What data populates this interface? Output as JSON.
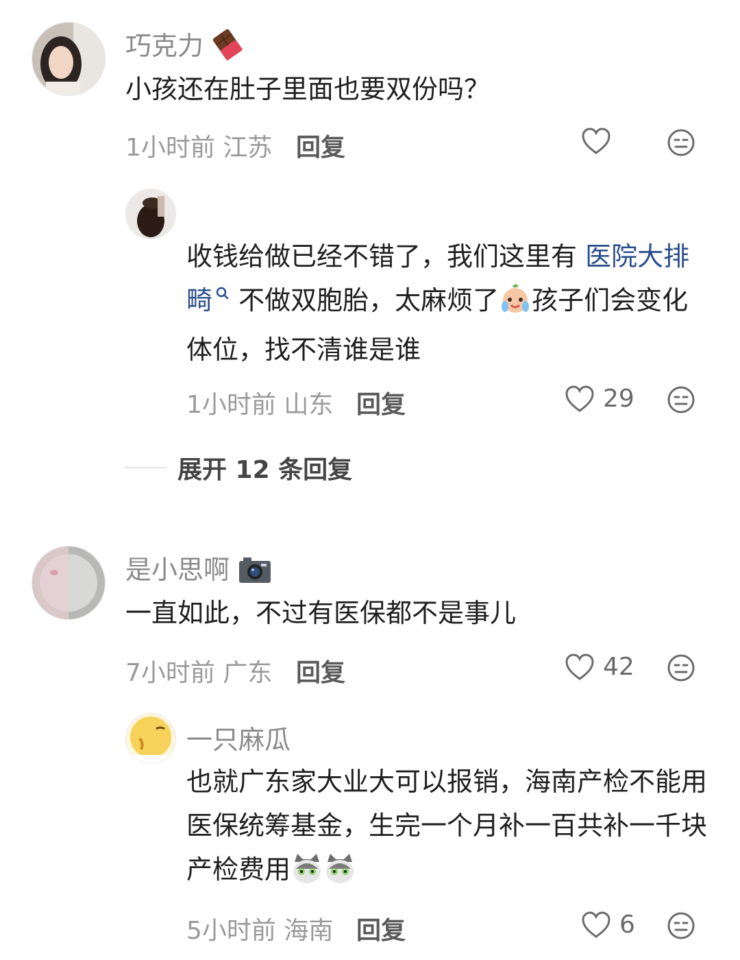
{
  "comments": [
    {
      "username": "巧克力",
      "text": "小孩还在肚子里面也要双份吗？",
      "time": "1小时前",
      "location": "江苏",
      "reply_label": "回复",
      "likes": ""
    },
    {
      "text_prefix": "收钱给做已经不错了，我们这里有 ",
      "link_text": "医院大排畸",
      "text_mid": " 不做双胞胎，太麻烦了",
      "text_suffix": "孩子们会变化体位，找不清谁是谁",
      "time": "1小时前",
      "location": "山东",
      "reply_label": "回复",
      "likes": "29"
    },
    {
      "username": "是小思啊",
      "text": "一直如此，不过有医保都不是事儿",
      "time": "7小时前",
      "location": "广东",
      "reply_label": "回复",
      "likes": "42"
    },
    {
      "username": "一只麻瓜",
      "text": "也就广东家大业大可以报销，海南产检不能用医保统筹基金，生完一个月补一百共补一千块产检费用",
      "time": "5小时前",
      "location": "海南",
      "reply_label": "回复",
      "likes": "6"
    }
  ],
  "expand_label": "展开 12 条回复",
  "icons": {
    "like": "heart-outline-icon",
    "dislike": "neutral-face-icon",
    "search": "search-icon"
  },
  "colors": {
    "link": "#2a4e8c",
    "meta": "#9a9a9a",
    "username": "#8a8a8a"
  }
}
